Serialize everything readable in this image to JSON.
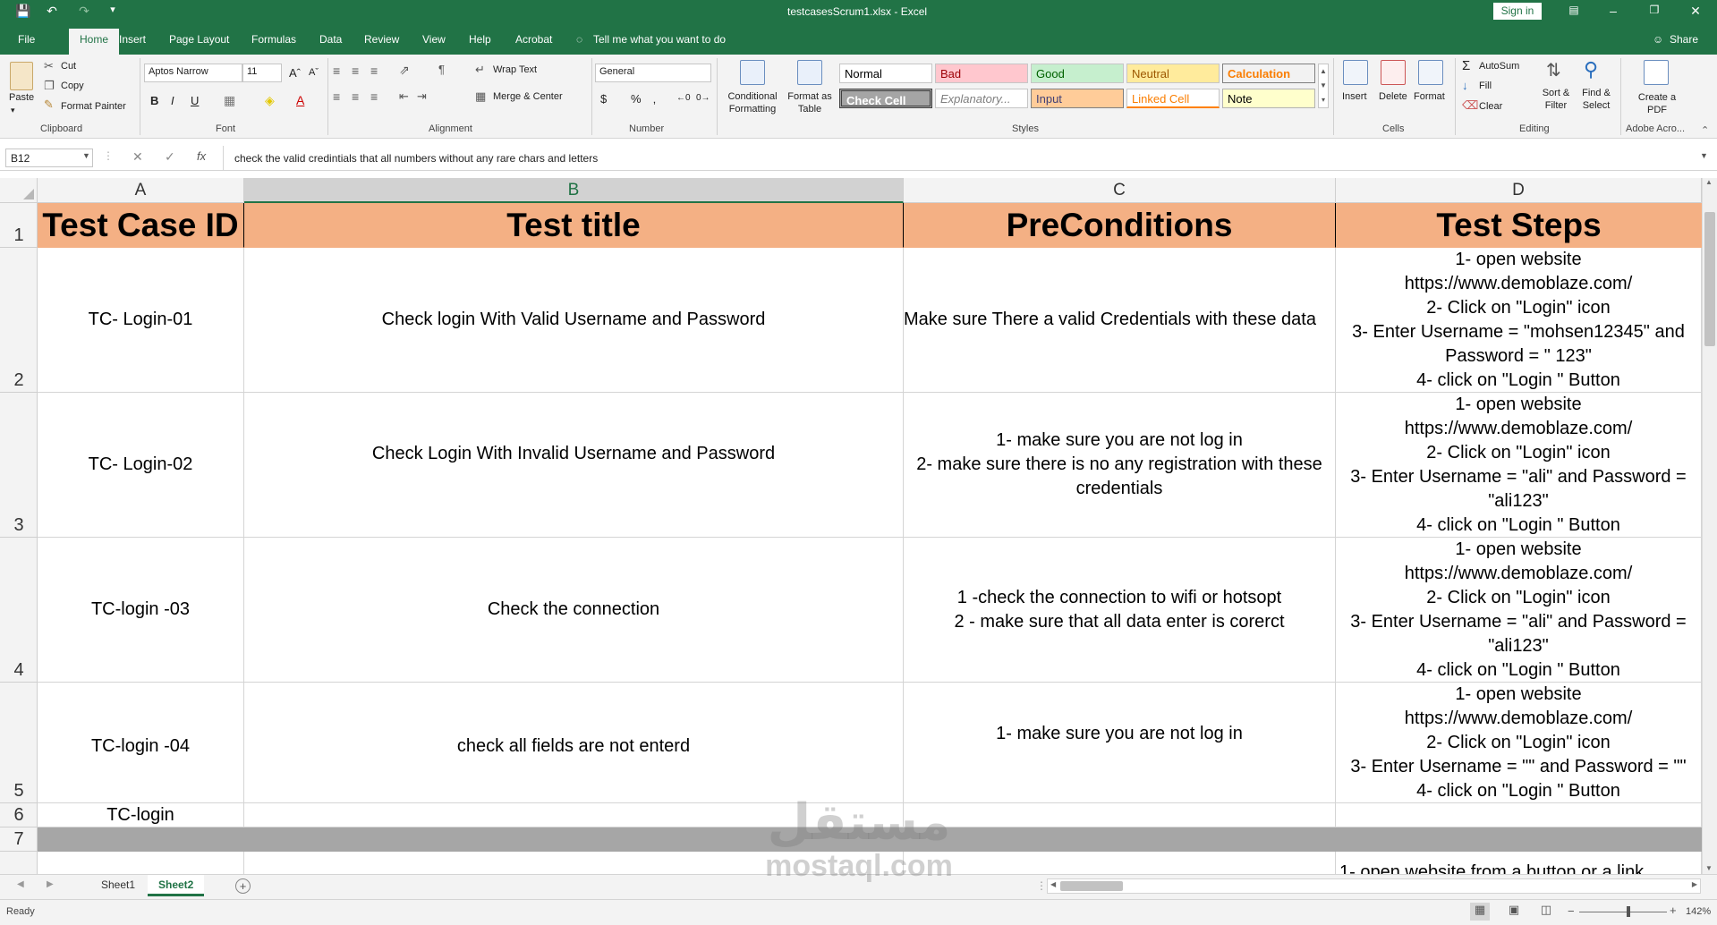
{
  "window": {
    "title": "testcasesScrum1.xlsx - Excel",
    "sign_in": "Sign in"
  },
  "tabs": [
    "File",
    "Home",
    "Insert",
    "Page Layout",
    "Formulas",
    "Data",
    "Review",
    "View",
    "Help",
    "Acrobat"
  ],
  "tell_me": "Tell me what you want to do",
  "share": "Share",
  "ribbon": {
    "clipboard": {
      "label": "Clipboard",
      "paste": "Paste",
      "cut": "Cut",
      "copy": "Copy",
      "format_painter": "Format Painter"
    },
    "font": {
      "label": "Font",
      "family": "Aptos Narrow",
      "size": "11"
    },
    "alignment": {
      "label": "Alignment",
      "wrap_text": "Wrap Text",
      "merge_center": "Merge & Center"
    },
    "number": {
      "label": "Number",
      "format": "General"
    },
    "styles": {
      "label": "Styles",
      "conditional_formatting": "Conditional Formatting",
      "format_as_table": "Format as Table",
      "cells": [
        {
          "name": "Normal",
          "bg": "#ffffff",
          "fg": "#000000"
        },
        {
          "name": "Bad",
          "bg": "#ffc7ce",
          "fg": "#9c0006"
        },
        {
          "name": "Good",
          "bg": "#c6efce",
          "fg": "#006100"
        },
        {
          "name": "Neutral",
          "bg": "#ffeb9c",
          "fg": "#9c5700"
        },
        {
          "name": "Calculation",
          "bg": "#f2f2f2",
          "fg": "#fa7d00"
        },
        {
          "name": "Check Cell",
          "bg": "#a5a5a5",
          "fg": "#ffffff"
        },
        {
          "name": "Explanatory...",
          "bg": "#ffffff",
          "fg": "#7f7f7f"
        },
        {
          "name": "Input",
          "bg": "#ffcc99",
          "fg": "#3f3f76"
        },
        {
          "name": "Linked Cell",
          "bg": "#ffffff",
          "fg": "#fa7d00"
        },
        {
          "name": "Note",
          "bg": "#ffffcc",
          "fg": "#000000"
        }
      ]
    },
    "cells": {
      "label": "Cells",
      "insert": "Insert",
      "delete": "Delete",
      "format": "Format"
    },
    "editing": {
      "label": "Editing",
      "autosum": "AutoSum",
      "fill": "Fill",
      "clear": "Clear",
      "sort_filter": "Sort & Filter",
      "find_select": "Find & Select"
    },
    "adobe": {
      "label": "Adobe Acro...",
      "create_pdf": "Create a PDF"
    }
  },
  "formula_bar": {
    "name_box": "B12",
    "content": "check the valid credintials that all numbers without any rare chars and letters"
  },
  "columns": [
    "A",
    "B",
    "C",
    "D"
  ],
  "rows": [
    "1",
    "2",
    "3",
    "4",
    "5",
    "6",
    "7"
  ],
  "cells": {
    "header": [
      "Test Case ID",
      "Test title",
      "PreConditions",
      "Test Steps"
    ],
    "r2": [
      "TC- Login-01",
      "Check login With Valid Username and Password",
      "Make sure There a valid Credentials with these data",
      "1- open website\nhttps://www.demoblaze.com/\n2- Click on \"Login\" icon\n3- Enter Username = \"mohsen12345\" and Password = \" 123\"\n4- click on \"Login \" Button"
    ],
    "r3": [
      "TC- Login-02",
      "Check Login With Invalid Username and Password",
      "1- make sure you are not log in\n2- make sure there is no any registration with these credentials",
      "1- open website\nhttps://www.demoblaze.com/\n2- Click on \"Login\" icon\n3- Enter Username = \"ali\" and Password = \"ali123\"\n4- click on \"Login \" Button"
    ],
    "r4": [
      "TC-login -03",
      "Check the connection",
      "1 -check the connection to wifi or hotsopt\n2 - make sure that all data enter is corerct",
      "1- open website\nhttps://www.demoblaze.com/\n2- Click on \"Login\" icon\n3- Enter Username = \"ali\" and Password = \"ali123\"\n4- click on \"Login \" Button"
    ],
    "r5": [
      "TC-login -04",
      "check all fields are not enterd",
      "1- make sure you are not log in",
      "1- open website\nhttps://www.demoblaze.com/\n2- Click on \"Login\" icon\n3- Enter Username = \"\" and Password = \"\"\n4- click on \"Login \" Button"
    ],
    "r6": [
      "TC-login",
      "",
      "",
      ""
    ],
    "r8_d": "1- open website from a button or a link"
  },
  "sheets": [
    "Sheet1",
    "Sheet2"
  ],
  "status": {
    "ready": "Ready",
    "zoom": "142%"
  },
  "watermark": {
    "arabic": "مستقل",
    "latin": "mostaql.com"
  }
}
